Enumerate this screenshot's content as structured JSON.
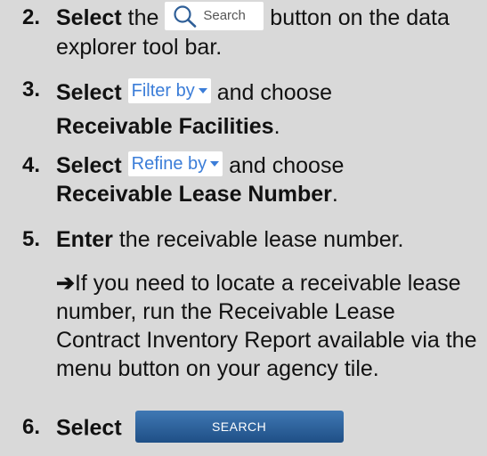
{
  "steps": [
    {
      "number": "2.",
      "verb": "Select",
      "pre": "the",
      "button_label": "Search",
      "post": "button on the data explorer tool bar."
    },
    {
      "number": "3.",
      "verb": "Select",
      "button_label": "Filter by",
      "post": "and choose",
      "target": "Receivable Facilities",
      "end": "."
    },
    {
      "number": "4.",
      "verb": "Select",
      "button_label": "Refine by",
      "post": "and choose",
      "target": "Receivable Lease Number",
      "end": "."
    },
    {
      "number": "5.",
      "verb": "Enter",
      "post": "the receivable lease number.",
      "note_arrow": "➔",
      "note": "If you need to locate a receivable lease number, run the Receivable Lease Contract Inventory Report available via the menu button on your agency tile."
    },
    {
      "number": "6.",
      "verb": "Select",
      "button_label": "SEARCH"
    }
  ],
  "icons": {
    "search": "search-magnifier-icon",
    "dropdown": "caret-down-icon"
  },
  "colors": {
    "background": "#d9d9d9",
    "link_blue": "#3b7dd8",
    "search_button_blue": "#2d62a0"
  }
}
